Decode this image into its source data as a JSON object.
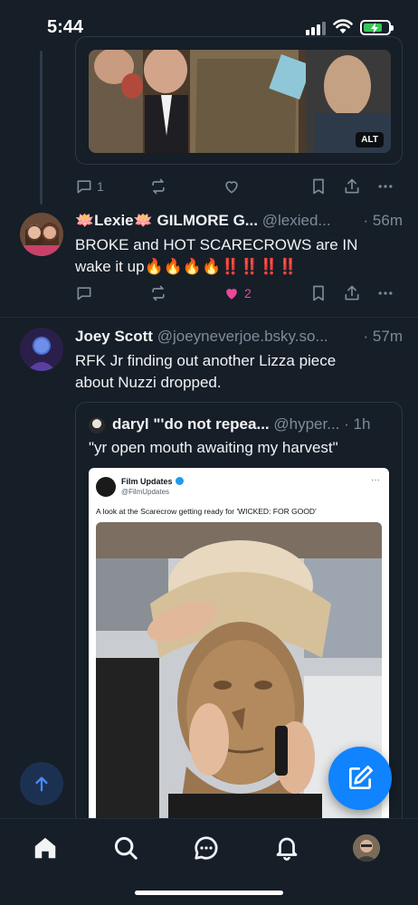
{
  "status_bar": {
    "time": "5:44"
  },
  "top_post": {
    "image_alt_badge": "ALT",
    "actions": {
      "replies": "1",
      "reposts": "",
      "likes": ""
    }
  },
  "post_lexie": {
    "display_name": "🪷Lexie🪷 GILMORE G...",
    "handle": "@lexied...",
    "time_ago": "· 56m",
    "text_line1": "BROKE and HOT SCARECROWS are IN",
    "text_line2": "wake it up🔥🔥🔥🔥‼️‼️‼️‼️",
    "likes": "2",
    "liked": true
  },
  "post_joey": {
    "display_name": "Joey Scott",
    "handle": "@joeyneverjoe.bsky.so...",
    "time_ago": "· 57m",
    "text_line1": "RFK Jr finding out another Lizza piece",
    "text_line2": "about Nuzzi dropped.",
    "quote": {
      "display_name": "daryl \"'do not repea...",
      "handle": "@hyper...",
      "time_ago": "· 1h",
      "text": "\"yr open mouth awaiting my harvest\"",
      "embedded_tweet": {
        "account_name": "Film Updates",
        "account_handle": "@FilmUpdates",
        "more": "···",
        "text": "A look at the Scarecrow getting ready for 'WICKED: FOR GOOD'"
      }
    }
  },
  "bottom_nav": {
    "items": [
      "home-icon",
      "search-icon",
      "chat-icon",
      "bell-icon",
      "profile-avatar"
    ]
  },
  "colors": {
    "background": "#161e27",
    "accent": "#1083fe",
    "like": "#ec4899",
    "muted": "#7e8b9a"
  }
}
